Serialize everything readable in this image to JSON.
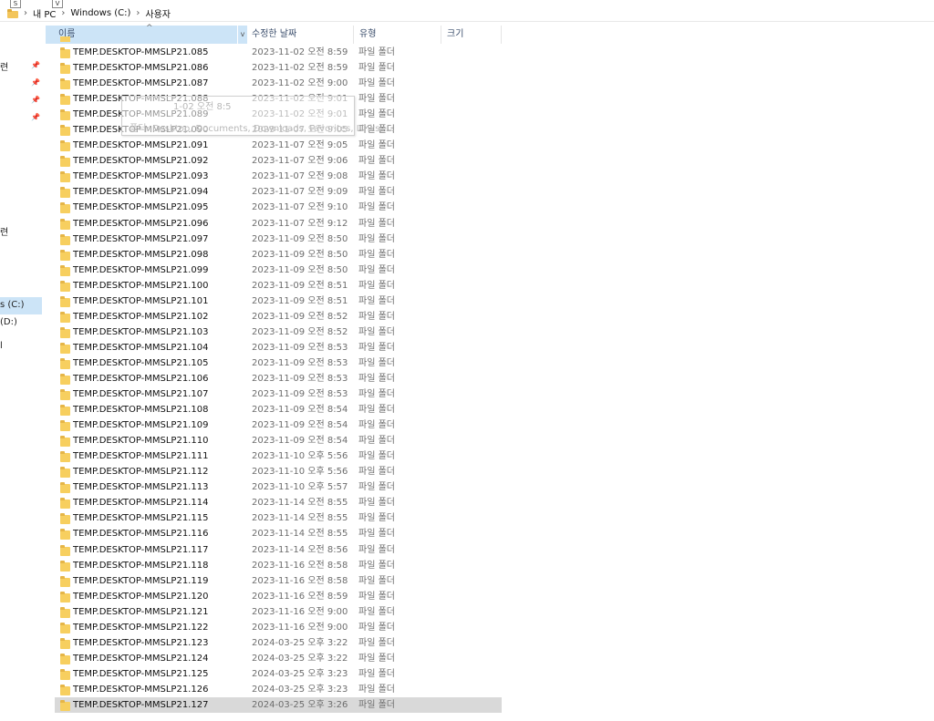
{
  "keytips": [
    "S",
    "V"
  ],
  "breadcrumb": [
    "내 PC",
    "Windows (C:)",
    "사용자"
  ],
  "nav": {
    "fragments": [
      "련",
      "·",
      "·",
      "·",
      "·",
      "련",
      "s (C:)",
      "(D:)",
      "l"
    ]
  },
  "columns": {
    "name": "이름",
    "date": "수정한 날짜",
    "type": "유형",
    "size": "크기",
    "sort_arrow": "^",
    "dropdown": "v"
  },
  "tooltip": {
    "line1": "1-02 오전 8:5",
    "line2": "폴더: Desktop, Documents, Downloads, Favorites, Links, ..."
  },
  "rows": [
    {
      "name": "TEMP.DESKTOP-MMSLP21.085",
      "date": "2023-11-02 오전 8:59",
      "type": "파일 폴더"
    },
    {
      "name": "TEMP.DESKTOP-MMSLP21.086",
      "date": "2023-11-02 오전 8:59",
      "type": "파일 폴더"
    },
    {
      "name": "TEMP.DESKTOP-MMSLP21.087",
      "date": "2023-11-02 오전 9:00",
      "type": "파일 폴더"
    },
    {
      "name": "TEMP.DESKTOP-MMSLP21.088",
      "date": "2023-11-02 오전 9:01",
      "type": "파일 폴더"
    },
    {
      "name": "TEMP.DESKTOP-MMSLP21.089",
      "date": "2023-11-02 오전 9:01",
      "type": "파일 폴더"
    },
    {
      "name": "TEMP.DESKTOP-MMSLP21.090",
      "date": "2023-11-07 오전 9:05",
      "type": "파일 폴더"
    },
    {
      "name": "TEMP.DESKTOP-MMSLP21.091",
      "date": "2023-11-07 오전 9:05",
      "type": "파일 폴더"
    },
    {
      "name": "TEMP.DESKTOP-MMSLP21.092",
      "date": "2023-11-07 오전 9:06",
      "type": "파일 폴더"
    },
    {
      "name": "TEMP.DESKTOP-MMSLP21.093",
      "date": "2023-11-07 오전 9:08",
      "type": "파일 폴더"
    },
    {
      "name": "TEMP.DESKTOP-MMSLP21.094",
      "date": "2023-11-07 오전 9:09",
      "type": "파일 폴더"
    },
    {
      "name": "TEMP.DESKTOP-MMSLP21.095",
      "date": "2023-11-07 오전 9:10",
      "type": "파일 폴더"
    },
    {
      "name": "TEMP.DESKTOP-MMSLP21.096",
      "date": "2023-11-07 오전 9:12",
      "type": "파일 폴더"
    },
    {
      "name": "TEMP.DESKTOP-MMSLP21.097",
      "date": "2023-11-09 오전 8:50",
      "type": "파일 폴더"
    },
    {
      "name": "TEMP.DESKTOP-MMSLP21.098",
      "date": "2023-11-09 오전 8:50",
      "type": "파일 폴더"
    },
    {
      "name": "TEMP.DESKTOP-MMSLP21.099",
      "date": "2023-11-09 오전 8:50",
      "type": "파일 폴더"
    },
    {
      "name": "TEMP.DESKTOP-MMSLP21.100",
      "date": "2023-11-09 오전 8:51",
      "type": "파일 폴더"
    },
    {
      "name": "TEMP.DESKTOP-MMSLP21.101",
      "date": "2023-11-09 오전 8:51",
      "type": "파일 폴더"
    },
    {
      "name": "TEMP.DESKTOP-MMSLP21.102",
      "date": "2023-11-09 오전 8:52",
      "type": "파일 폴더"
    },
    {
      "name": "TEMP.DESKTOP-MMSLP21.103",
      "date": "2023-11-09 오전 8:52",
      "type": "파일 폴더"
    },
    {
      "name": "TEMP.DESKTOP-MMSLP21.104",
      "date": "2023-11-09 오전 8:53",
      "type": "파일 폴더"
    },
    {
      "name": "TEMP.DESKTOP-MMSLP21.105",
      "date": "2023-11-09 오전 8:53",
      "type": "파일 폴더"
    },
    {
      "name": "TEMP.DESKTOP-MMSLP21.106",
      "date": "2023-11-09 오전 8:53",
      "type": "파일 폴더"
    },
    {
      "name": "TEMP.DESKTOP-MMSLP21.107",
      "date": "2023-11-09 오전 8:53",
      "type": "파일 폴더"
    },
    {
      "name": "TEMP.DESKTOP-MMSLP21.108",
      "date": "2023-11-09 오전 8:54",
      "type": "파일 폴더"
    },
    {
      "name": "TEMP.DESKTOP-MMSLP21.109",
      "date": "2023-11-09 오전 8:54",
      "type": "파일 폴더"
    },
    {
      "name": "TEMP.DESKTOP-MMSLP21.110",
      "date": "2023-11-09 오전 8:54",
      "type": "파일 폴더"
    },
    {
      "name": "TEMP.DESKTOP-MMSLP21.111",
      "date": "2023-11-10 오후 5:56",
      "type": "파일 폴더"
    },
    {
      "name": "TEMP.DESKTOP-MMSLP21.112",
      "date": "2023-11-10 오후 5:56",
      "type": "파일 폴더"
    },
    {
      "name": "TEMP.DESKTOP-MMSLP21.113",
      "date": "2023-11-10 오후 5:57",
      "type": "파일 폴더"
    },
    {
      "name": "TEMP.DESKTOP-MMSLP21.114",
      "date": "2023-11-14 오전 8:55",
      "type": "파일 폴더"
    },
    {
      "name": "TEMP.DESKTOP-MMSLP21.115",
      "date": "2023-11-14 오전 8:55",
      "type": "파일 폴더"
    },
    {
      "name": "TEMP.DESKTOP-MMSLP21.116",
      "date": "2023-11-14 오전 8:55",
      "type": "파일 폴더"
    },
    {
      "name": "TEMP.DESKTOP-MMSLP21.117",
      "date": "2023-11-14 오전 8:56",
      "type": "파일 폴더"
    },
    {
      "name": "TEMP.DESKTOP-MMSLP21.118",
      "date": "2023-11-16 오전 8:58",
      "type": "파일 폴더"
    },
    {
      "name": "TEMP.DESKTOP-MMSLP21.119",
      "date": "2023-11-16 오전 8:58",
      "type": "파일 폴더"
    },
    {
      "name": "TEMP.DESKTOP-MMSLP21.120",
      "date": "2023-11-16 오전 8:59",
      "type": "파일 폴더"
    },
    {
      "name": "TEMP.DESKTOP-MMSLP21.121",
      "date": "2023-11-16 오전 9:00",
      "type": "파일 폴더"
    },
    {
      "name": "TEMP.DESKTOP-MMSLP21.122",
      "date": "2023-11-16 오전 9:00",
      "type": "파일 폴더"
    },
    {
      "name": "TEMP.DESKTOP-MMSLP21.123",
      "date": "2024-03-25 오후 3:22",
      "type": "파일 폴더"
    },
    {
      "name": "TEMP.DESKTOP-MMSLP21.124",
      "date": "2024-03-25 오후 3:22",
      "type": "파일 폴더"
    },
    {
      "name": "TEMP.DESKTOP-MMSLP21.125",
      "date": "2024-03-25 오후 3:23",
      "type": "파일 폴더"
    },
    {
      "name": "TEMP.DESKTOP-MMSLP21.126",
      "date": "2024-03-25 오후 3:23",
      "type": "파일 폴더"
    },
    {
      "name": "TEMP.DESKTOP-MMSLP21.127",
      "date": "2024-03-25 오후 3:26",
      "type": "파일 폴더",
      "selected": true
    }
  ]
}
